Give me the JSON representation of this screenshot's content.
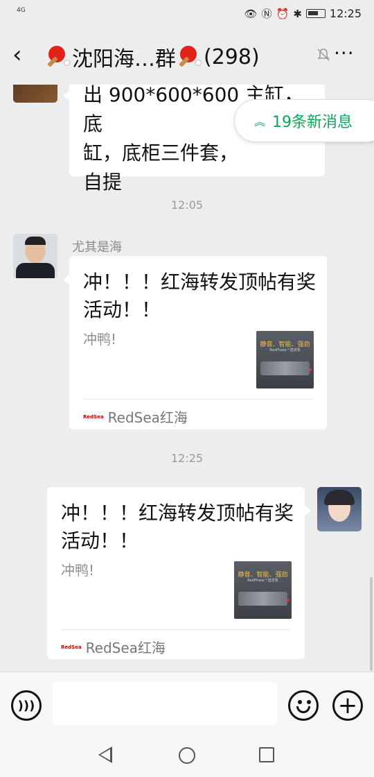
{
  "status_bar": {
    "network": "4G",
    "time": "12:25"
  },
  "header": {
    "back_icon": "back-chevron-icon",
    "title_main": "沈阳海…群",
    "title_count": "(298)"
  },
  "new_message_pill": {
    "label": "19条新消息"
  },
  "partial_message": {
    "lines": [
      "出 900*600*600 主缸，底",
      "缸，底柜三件套，",
      "自提"
    ]
  },
  "timestamps": [
    "12:05",
    "12:25"
  ],
  "messages": [
    {
      "sender": "尤其是海",
      "card": {
        "title": "冲！！！红海转发顶帖有奖活动！！",
        "desc": "冲鸭!",
        "thumb_title": "静音、智能、强劲",
        "thumb_sub": "RedPhase™直流泵",
        "source": "RedSea红海",
        "logo_text": "RedSea"
      }
    },
    {
      "sender": "",
      "card": {
        "title": "冲！！！红海转发顶帖有奖活动！！",
        "desc": "冲鸭!",
        "thumb_title": "静音、智能、强劲",
        "thumb_sub": "RedPhase™直流泵",
        "source": "RedSea红海",
        "logo_text": "RedSea"
      }
    }
  ],
  "input": {
    "placeholder": ""
  },
  "colors": {
    "accent_green": "#07a85a",
    "background": "#ededed",
    "bubble": "#ffffff"
  }
}
